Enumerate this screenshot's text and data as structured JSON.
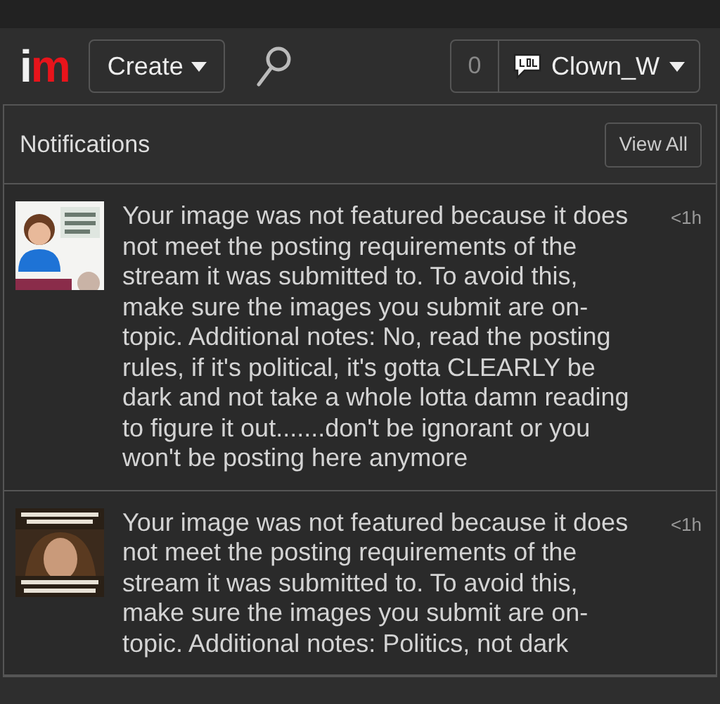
{
  "header": {
    "logo": [
      {
        "text": "i",
        "color": "#f2f2f2"
      },
      {
        "text": "m",
        "color": "#e8141b"
      }
    ],
    "create_button": "Create",
    "count": "0",
    "user_button": "Clown_W"
  },
  "notifications": {
    "title": "Notifications",
    "view_all": "View All",
    "items": [
      {
        "message": "Your image was not featured because it does not meet the posting requirements of the stream it was submitted to. To avoid this, make sure the images you submit are on-topic. Additional notes: No, read the posting rules, if it's political, it's gotta CLEARLY be dark and not take a whole lotta damn reading to figure it out.......don't be ignorant or you won't be posting here anymore",
        "time": "<1h"
      },
      {
        "message": "Your image was not featured because it does not meet the posting requirements of the stream it was submitted to. To avoid this, make sure the images you submit are on-topic. Additional notes: Politics, not dark",
        "time": "<1h"
      }
    ]
  }
}
